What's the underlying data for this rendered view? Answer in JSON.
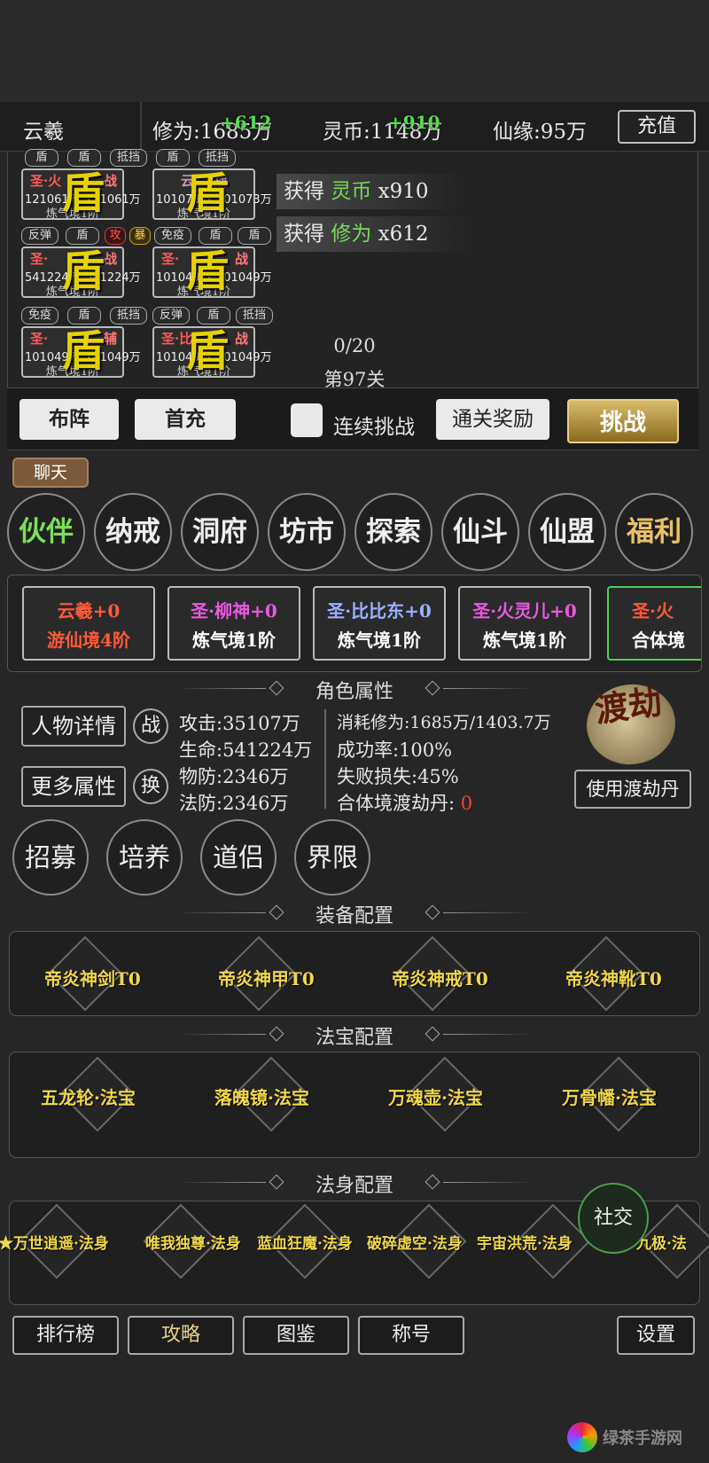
{
  "header": {
    "player_name": "云羲",
    "cultivation": "修为:1685万",
    "spirit_coin": "灵币:1148万",
    "fate": "仙缘:95万",
    "float_cultivation": "+612",
    "float_coin": "+910",
    "recharge_label": "充值"
  },
  "battle": {
    "rows": [
      {
        "tags": [
          "盾",
          "盾",
          "抵挡",
          "盾",
          "抵挡"
        ],
        "cards": [
          {
            "name": "圣·火",
            "name2": "战",
            "hp": "121061万",
            "hp2": "121061万",
            "realm": "炼气境1阶"
          },
          {
            "name": "云",
            "name2": "战",
            "hp": "101073万",
            "hp2": "101073万",
            "realm": "炼气境1阶"
          }
        ]
      },
      {
        "tags": [
          "反弹",
          "盾",
          "攻",
          "暴",
          "免疫",
          "盾",
          "盾"
        ],
        "cards": [
          {
            "name": "圣·",
            "name2": "战",
            "hp": "541224万",
            "hp2": "541224万",
            "realm": "炼气境1阶"
          },
          {
            "name": "圣·",
            "name2": "战",
            "hp": "101049万",
            "hp2": "101049万",
            "realm": "炼气境1阶"
          }
        ]
      },
      {
        "tags": [
          "免疫",
          "盾",
          "抵挡",
          "反弹",
          "盾",
          "抵挡"
        ],
        "cards": [
          {
            "name": "圣·",
            "name2": "辅",
            "hp": "101049万",
            "hp2": "101049万",
            "realm": "炼气境1阶"
          },
          {
            "name": "圣·比",
            "name2": "战",
            "hp": "101049万",
            "hp2": "101049万",
            "realm": "炼气境1阶"
          }
        ]
      }
    ],
    "shield_char": "盾",
    "gain1": {
      "prefix": "获得",
      "item": "灵币",
      "amount": "x910"
    },
    "gain2": {
      "prefix": "获得",
      "item": "修为",
      "amount": "x612"
    },
    "wave": "0/20",
    "stage": "第97关"
  },
  "actions": {
    "formation": "布阵",
    "first_charge": "首充",
    "continuous": "连续挑战",
    "clear_reward": "通关奖励",
    "challenge": "挑战"
  },
  "chat_tab": "聊天",
  "nav": [
    "伙伴",
    "纳戒",
    "洞府",
    "坊市",
    "探索",
    "仙斗",
    "仙盟",
    "福利"
  ],
  "companions": [
    {
      "name": "云羲+0",
      "realm": "游仙境4阶",
      "name_color": "#ff5a3a",
      "realm_color": "#ff5a3a"
    },
    {
      "name": "圣·柳神+0",
      "realm": "炼气境1阶",
      "name_color": "#e85ae0",
      "realm_color": "#ffffff"
    },
    {
      "name": "圣·比比东+0",
      "realm": "炼气境1阶",
      "name_color": "#9ab0ff",
      "realm_color": "#ffffff"
    },
    {
      "name": "圣·火灵儿+0",
      "realm": "炼气境1阶",
      "name_color": "#e85ae0",
      "realm_color": "#ffffff"
    },
    {
      "name": "圣·火",
      "realm": "合体境",
      "name_color": "#ff5a3a",
      "realm_color": "#ffffff"
    }
  ],
  "attributes": {
    "title": "角色属性",
    "details_btn": "人物详情",
    "more_btn": "更多属性",
    "fight_icon": "战",
    "swap_icon": "换",
    "attack": "攻击:35107万",
    "hp": "生命:541224万",
    "phys_def": "物防:2346万",
    "mag_def": "法防:2346万",
    "consume": "消耗修为:1685万/1403.7万",
    "success": "成功率:100%",
    "fail_loss": "失败损失:45%",
    "pill_label": "合体境渡劫丹:",
    "pill_count": "0",
    "dujie": "渡劫",
    "use_pill": "使用渡劫丹"
  },
  "sub_nav": [
    "招募",
    "培养",
    "道侣",
    "界限"
  ],
  "equipment": {
    "title": "装备配置",
    "items": [
      "帝炎神剑T0",
      "帝炎神甲T0",
      "帝炎神戒T0",
      "帝炎神靴T0"
    ]
  },
  "treasure": {
    "title": "法宝配置",
    "items": [
      "五龙轮·法宝",
      "落魄镜·法宝",
      "万魂壶·法宝",
      "万骨幡·法宝"
    ]
  },
  "body": {
    "title": "法身配置",
    "items": [
      "★万世逍遥·法身",
      "唯我独尊·法身",
      "蓝血狂魔·法身",
      "破碎虚空·法身",
      "宇宙洪荒·法身",
      "九极·法"
    ]
  },
  "social": "社交",
  "bottom": [
    "排行榜",
    "攻略",
    "图鉴",
    "称号",
    "设置"
  ],
  "watermark": "绿茶手游网"
}
